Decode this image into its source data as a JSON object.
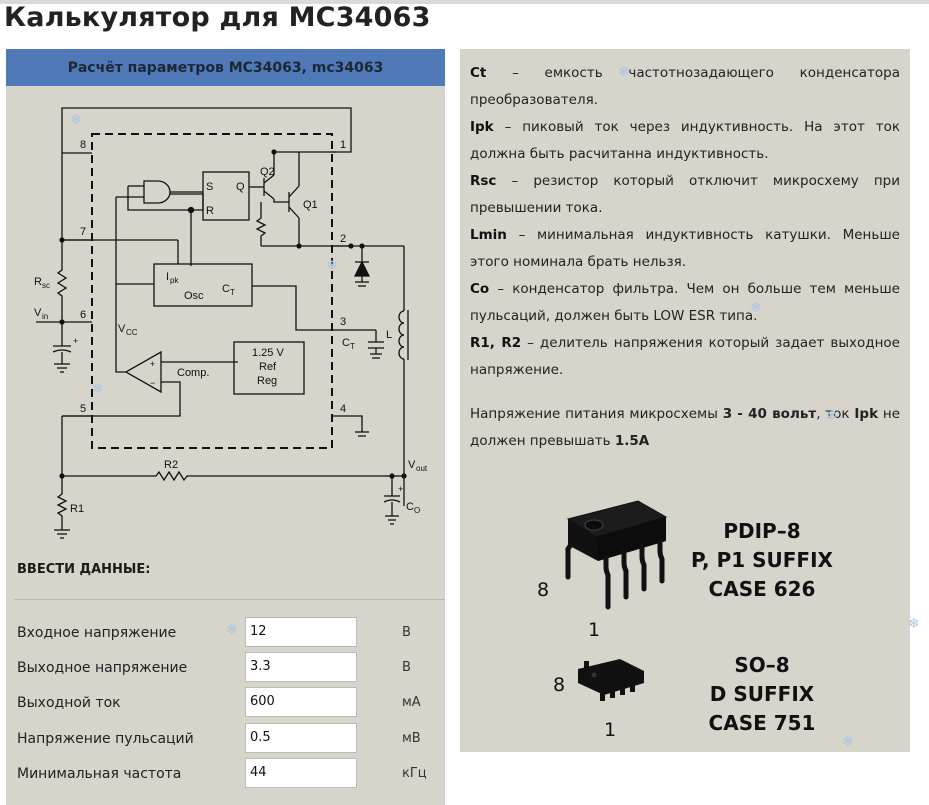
{
  "page": {
    "title": "Калькулятор для MC34063"
  },
  "calculator": {
    "header": "Расчёт параметров MC34063, mc34063",
    "schematic": {
      "labels": {
        "pin1": "1",
        "pin2": "2",
        "pin3": "3",
        "pin4": "4",
        "pin5": "5",
        "pin6": "6",
        "pin7": "7",
        "pin8": "8",
        "rsc": "R",
        "rsc_sub": "sc",
        "vin": "V",
        "vin_sub": "in",
        "vcc": "V",
        "vcc_sub": "CC",
        "s": "S",
        "r": "R",
        "q": "Q",
        "q1": "Q1",
        "q2": "Q2",
        "ipk": "I",
        "ipk_sub": "pk",
        "osc": "Osc",
        "ct_block": "C",
        "ct_block_sub": "T",
        "ct": "C",
        "ct_sub": "T",
        "l": "L",
        "ref1": "1.25 V",
        "ref2": "Ref",
        "ref3": "Reg",
        "comp": "Comp.",
        "plus": "+",
        "minus": "−",
        "r2": "R2",
        "r1": "R1",
        "vout": "V",
        "vout_sub": "out",
        "co": "C",
        "co_sub": "O"
      }
    },
    "form": {
      "heading": "ВВЕСТИ ДАННЫЕ:",
      "rows": [
        {
          "label": "Входное напряжение",
          "value": "12",
          "unit": "В"
        },
        {
          "label": "Выходное напряжение",
          "value": "3.3",
          "unit": "В"
        },
        {
          "label": "Выходной ток",
          "value": "600",
          "unit": "мА"
        },
        {
          "label": "Напряжение пульсаций",
          "value": "0.5",
          "unit": "мВ"
        },
        {
          "label": "Минимальная частота",
          "value": "44",
          "unit": "кГц"
        }
      ]
    }
  },
  "info": {
    "items": [
      {
        "term": "Ct",
        "text": " – емкость частотнозадающего конденсатора преобразователя."
      },
      {
        "term": "Ipk",
        "text": " – пиковый ток через индуктивность. На этот ток должна быть расчитанна индуктивность."
      },
      {
        "term": "Rsc",
        "text": " – резистор который отключит микросхему при превышении тока."
      },
      {
        "term": "Lmin",
        "text": " – минимальная индуктивность катушки. Меньше этого номинала брать нельзя."
      },
      {
        "term": "Co",
        "text": " – конденсатор фильтра. Чем он больше тем меньше пульсаций, должен быть LOW ESR типа."
      },
      {
        "term": "R1, R2",
        "text": " – делитель напряжения который задает выходное напряжение."
      }
    ],
    "note": {
      "p1": "Напряжение питания микросхемы ",
      "b1": "3 - 40 вольт",
      "p2": ", ток ",
      "b2": "Ipk",
      "p3": " не должен превышать ",
      "b3": "1.5A"
    },
    "packages": {
      "pdip": {
        "line1": "PDIP–8",
        "line2": "P, P1 SUFFIX",
        "line3": "CASE 626",
        "pin_top": "8",
        "pin_bottom": "1"
      },
      "so8": {
        "line1": "SO–8",
        "line2": "D SUFFIX",
        "line3": "CASE 751",
        "pin_top": "8",
        "pin_bottom": "1"
      }
    }
  }
}
